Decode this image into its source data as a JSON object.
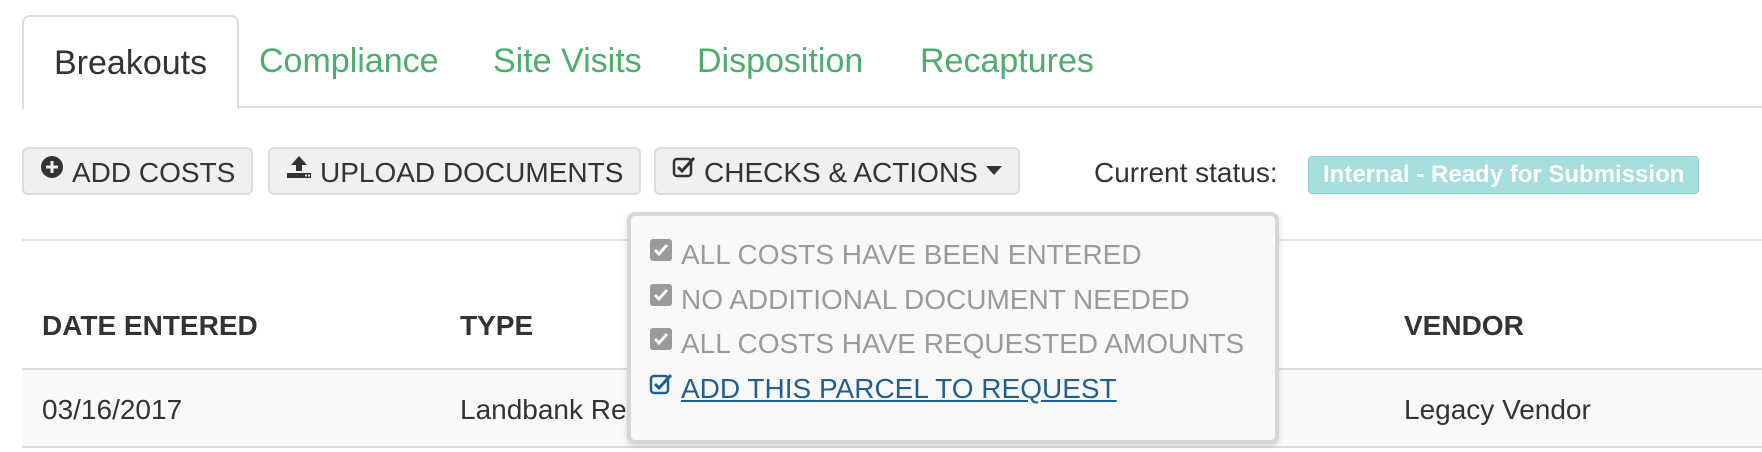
{
  "tabs": [
    {
      "label": "Breakouts",
      "active": true
    },
    {
      "label": "Compliance",
      "active": false
    },
    {
      "label": "Site Visits",
      "active": false
    },
    {
      "label": "Disposition",
      "active": false
    },
    {
      "label": "Recaptures",
      "active": false
    }
  ],
  "toolbar": {
    "add_costs": {
      "label": "ADD COSTS",
      "icon": "plus-circle-icon"
    },
    "upload_documents": {
      "label": "UPLOAD DOCUMENTS",
      "icon": "upload-icon"
    },
    "checks_actions": {
      "label": "CHECKS & ACTIONS",
      "icon": "checkbox-icon"
    }
  },
  "status": {
    "label": "Current status:",
    "value": "Internal - Ready for Submission",
    "color": "#a6dddd"
  },
  "table": {
    "headers": [
      "DATE ENTERED",
      "TYPE",
      "VENDOR"
    ],
    "rows": [
      {
        "date": "03/16/2017",
        "type": "Landbank Re",
        "vendor": "Legacy Vendor"
      }
    ]
  },
  "dropdown": {
    "items": [
      {
        "label": "ALL COSTS HAVE BEEN ENTERED",
        "checked": true,
        "enabled": false
      },
      {
        "label": "NO ADDITIONAL DOCUMENT NEEDED",
        "checked": true,
        "enabled": false
      },
      {
        "label": "ALL COSTS HAVE REQUESTED AMOUNTS",
        "checked": true,
        "enabled": false
      },
      {
        "label": " ADD THIS PARCEL TO REQUEST",
        "checked": true,
        "enabled": true
      }
    ]
  },
  "colors": {
    "tab_link": "#4cae6d",
    "action_link": "#1f5f96",
    "disabled_text": "#9a9a9a"
  }
}
